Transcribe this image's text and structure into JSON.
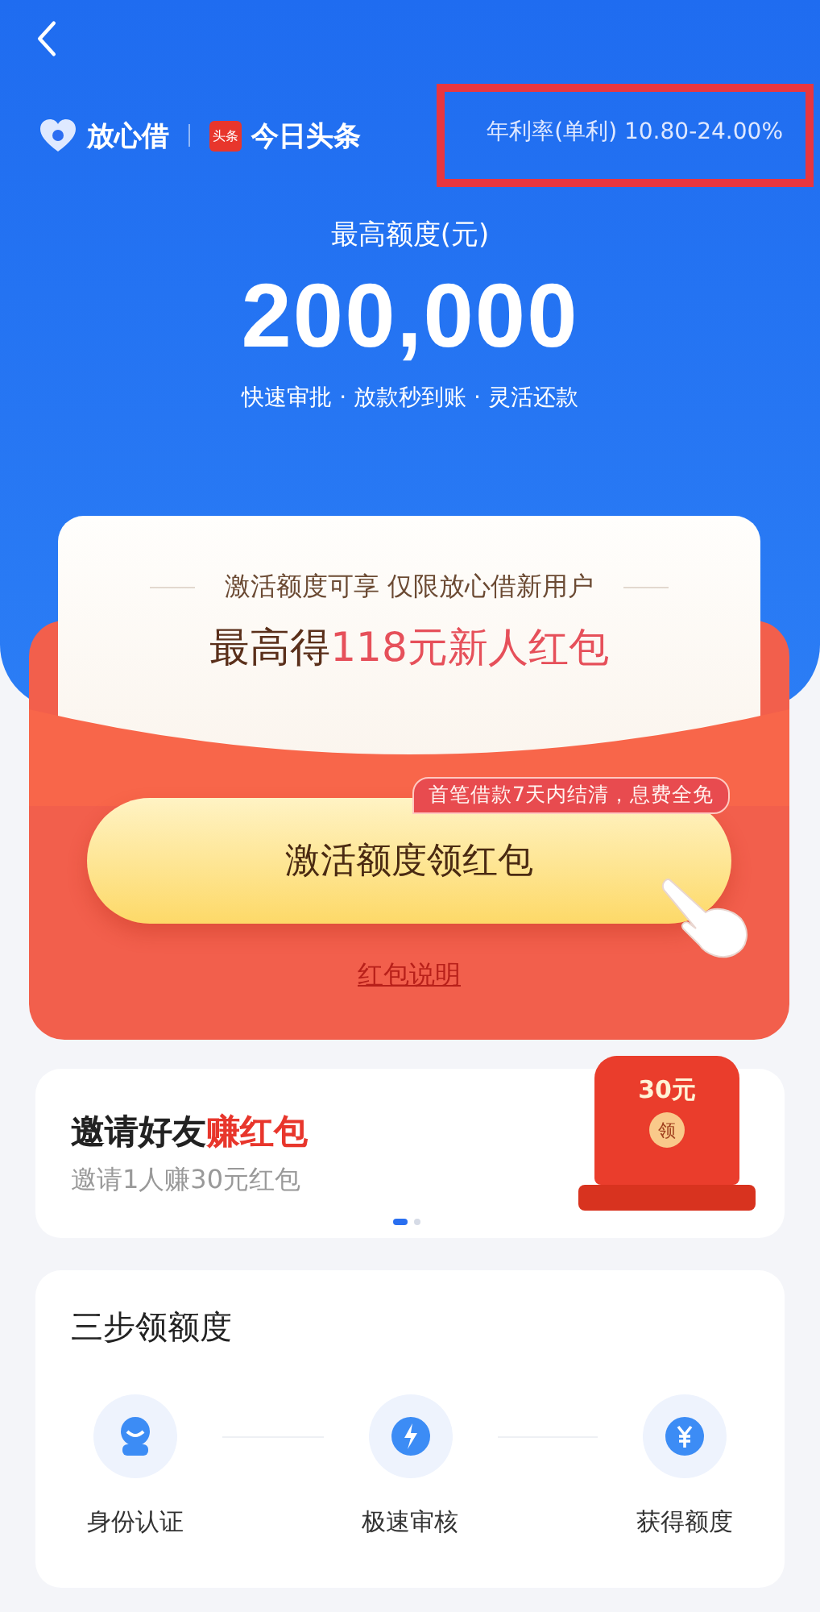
{
  "header": {
    "brand": "放心借",
    "partner_badge": "头条",
    "partner": "今日头条",
    "rate": "年利率(单利) 10.80-24.00%",
    "limit_label": "最高额度(元)",
    "limit": "200,000",
    "features": "快速审批 · 放款秒到账 · 灵活还款"
  },
  "promo": {
    "subtitle": "激活额度可享 仅限放心借新用户",
    "headline_lead": "最高得",
    "headline_highlight": "118元新人红包",
    "tag": "首笔借款7天内结清，息费全免",
    "button": "激活额度领红包",
    "link": "红包说明"
  },
  "invite": {
    "title_lead": "邀请好友",
    "title_highlight": "赚红包",
    "subtitle": "邀请1人赚30元红包",
    "art_amount": "30元",
    "art_seal": "领",
    "dots": [
      {
        "selected": true
      },
      {
        "selected": false
      }
    ]
  },
  "steps": {
    "title": "三步领额度",
    "items": [
      {
        "kind": "id",
        "label": "身份认证"
      },
      {
        "kind": "speed",
        "label": "极速审核"
      },
      {
        "kind": "money",
        "label": "获得额度"
      }
    ]
  }
}
